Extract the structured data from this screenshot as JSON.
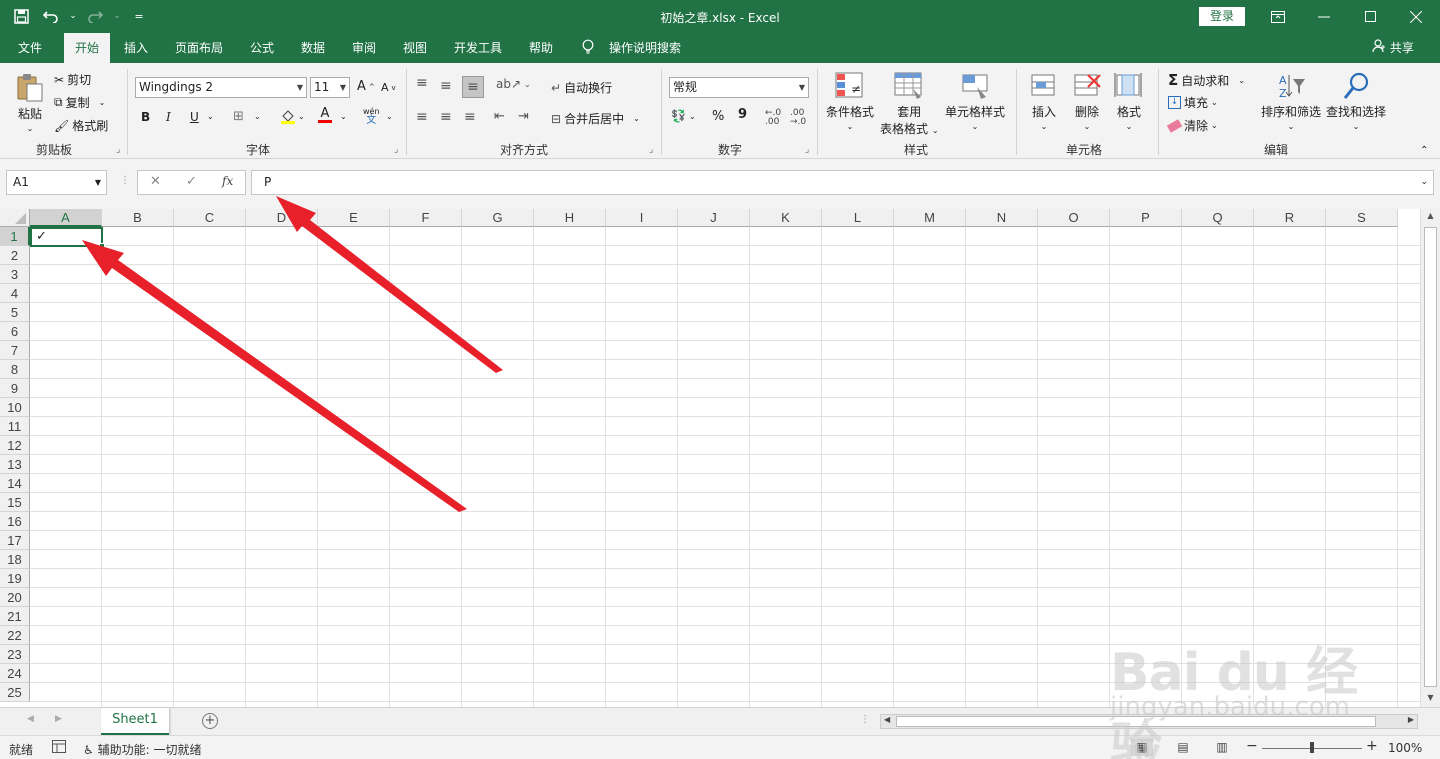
{
  "titlebar": {
    "title": "初始之章.xlsx  -  Excel",
    "login": "登录",
    "qat_more": "⌄"
  },
  "tabs": [
    "文件",
    "开始",
    "插入",
    "页面布局",
    "公式",
    "数据",
    "审阅",
    "视图",
    "开发工具",
    "帮助"
  ],
  "tell_me": "操作说明搜索",
  "share": "共享",
  "ribbon": {
    "clipboard": {
      "paste": "粘贴",
      "cut": "剪切",
      "copy": "复制",
      "format_painter": "格式刷",
      "label": "剪贴板"
    },
    "font": {
      "name": "Wingdings 2",
      "size": "11",
      "bold": "B",
      "italic": "I",
      "underline": "U",
      "grow": "A",
      "shrink": "A",
      "font_color": "A",
      "phonetic": "wén",
      "label": "字体"
    },
    "alignment": {
      "wrap": "自动换行",
      "merge": "合并后居中",
      "label": "对齐方式"
    },
    "number": {
      "format": "常规",
      "percent": "%",
      "comma": "9",
      "label": "数字"
    },
    "styles": {
      "conditional": "条件格式",
      "table_line1": "套用",
      "table_line2": "表格格式",
      "cell_styles": "单元格样式",
      "label": "样式"
    },
    "cells": {
      "insert": "插入",
      "delete": "删除",
      "format": "格式",
      "label": "单元格"
    },
    "editing": {
      "autosum": "自动求和",
      "fill": "填充",
      "clear": "清除",
      "sort": "排序和筛选",
      "find": "查找和选择",
      "label": "编辑"
    }
  },
  "formula_bar": {
    "name_box": "A1",
    "fx": "fx",
    "value": "P"
  },
  "columns": [
    "A",
    "B",
    "C",
    "D",
    "E",
    "F",
    "G",
    "H",
    "I",
    "J",
    "K",
    "L",
    "M",
    "N",
    "O",
    "P",
    "Q",
    "R",
    "S"
  ],
  "rows": [
    "1",
    "2",
    "3",
    "4",
    "5",
    "6",
    "7",
    "8",
    "9",
    "10",
    "11",
    "12",
    "13",
    "14",
    "15",
    "16",
    "17",
    "18",
    "19",
    "20",
    "21",
    "22",
    "23",
    "24",
    "25"
  ],
  "cell_a1": "✓",
  "sheet_tab": "Sheet1",
  "status": {
    "ready": "就绪",
    "accessibility": "辅助功能: 一切就绪",
    "zoom": "100%"
  },
  "watermark": {
    "brand": "Bai du 经验",
    "url": "jingyan.baidu.com"
  },
  "colors": {
    "excel_green": "#217346",
    "arrow_red": "#e8202a"
  }
}
